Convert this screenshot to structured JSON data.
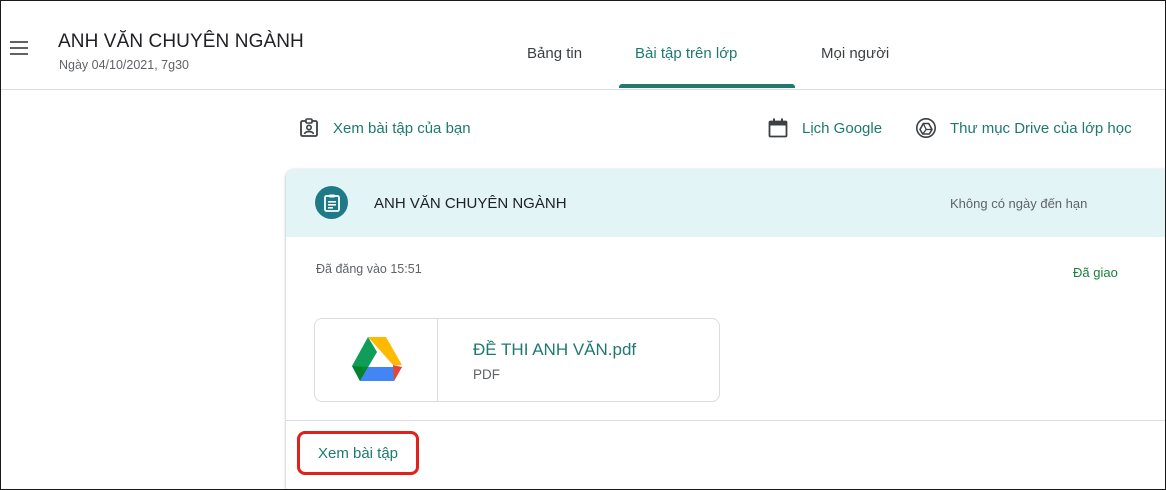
{
  "header": {
    "class_title": "ANH VĂN CHUYÊN NGÀNH",
    "class_subtitle": "Ngày 04/10/2021, 7g30",
    "tabs": [
      {
        "label": "Bảng tin",
        "active": false
      },
      {
        "label": "Bài tập trên lớp",
        "active": true
      },
      {
        "label": "Mọi người",
        "active": false
      }
    ]
  },
  "actions": {
    "view_your_work": "Xem bài tập của bạn",
    "google_calendar": "Lịch Google",
    "class_drive": "Thư mục Drive của lớp học"
  },
  "assignment": {
    "title": "ANH VĂN CHUYÊN NGÀNH",
    "due": "Không có ngày đến hạn",
    "posted": "Đã đăng vào 15:51",
    "status": "Đã giao",
    "attachment": {
      "name": "ĐỀ THI ANH VĂN.pdf",
      "type": "PDF",
      "icon": "google-drive-icon"
    },
    "view_button": "Xem bài tập"
  },
  "colors": {
    "accent": "#1e7a6e",
    "status_green": "#188038",
    "card_header_bg": "#e3f4f7",
    "highlight_red": "#e0201a"
  }
}
